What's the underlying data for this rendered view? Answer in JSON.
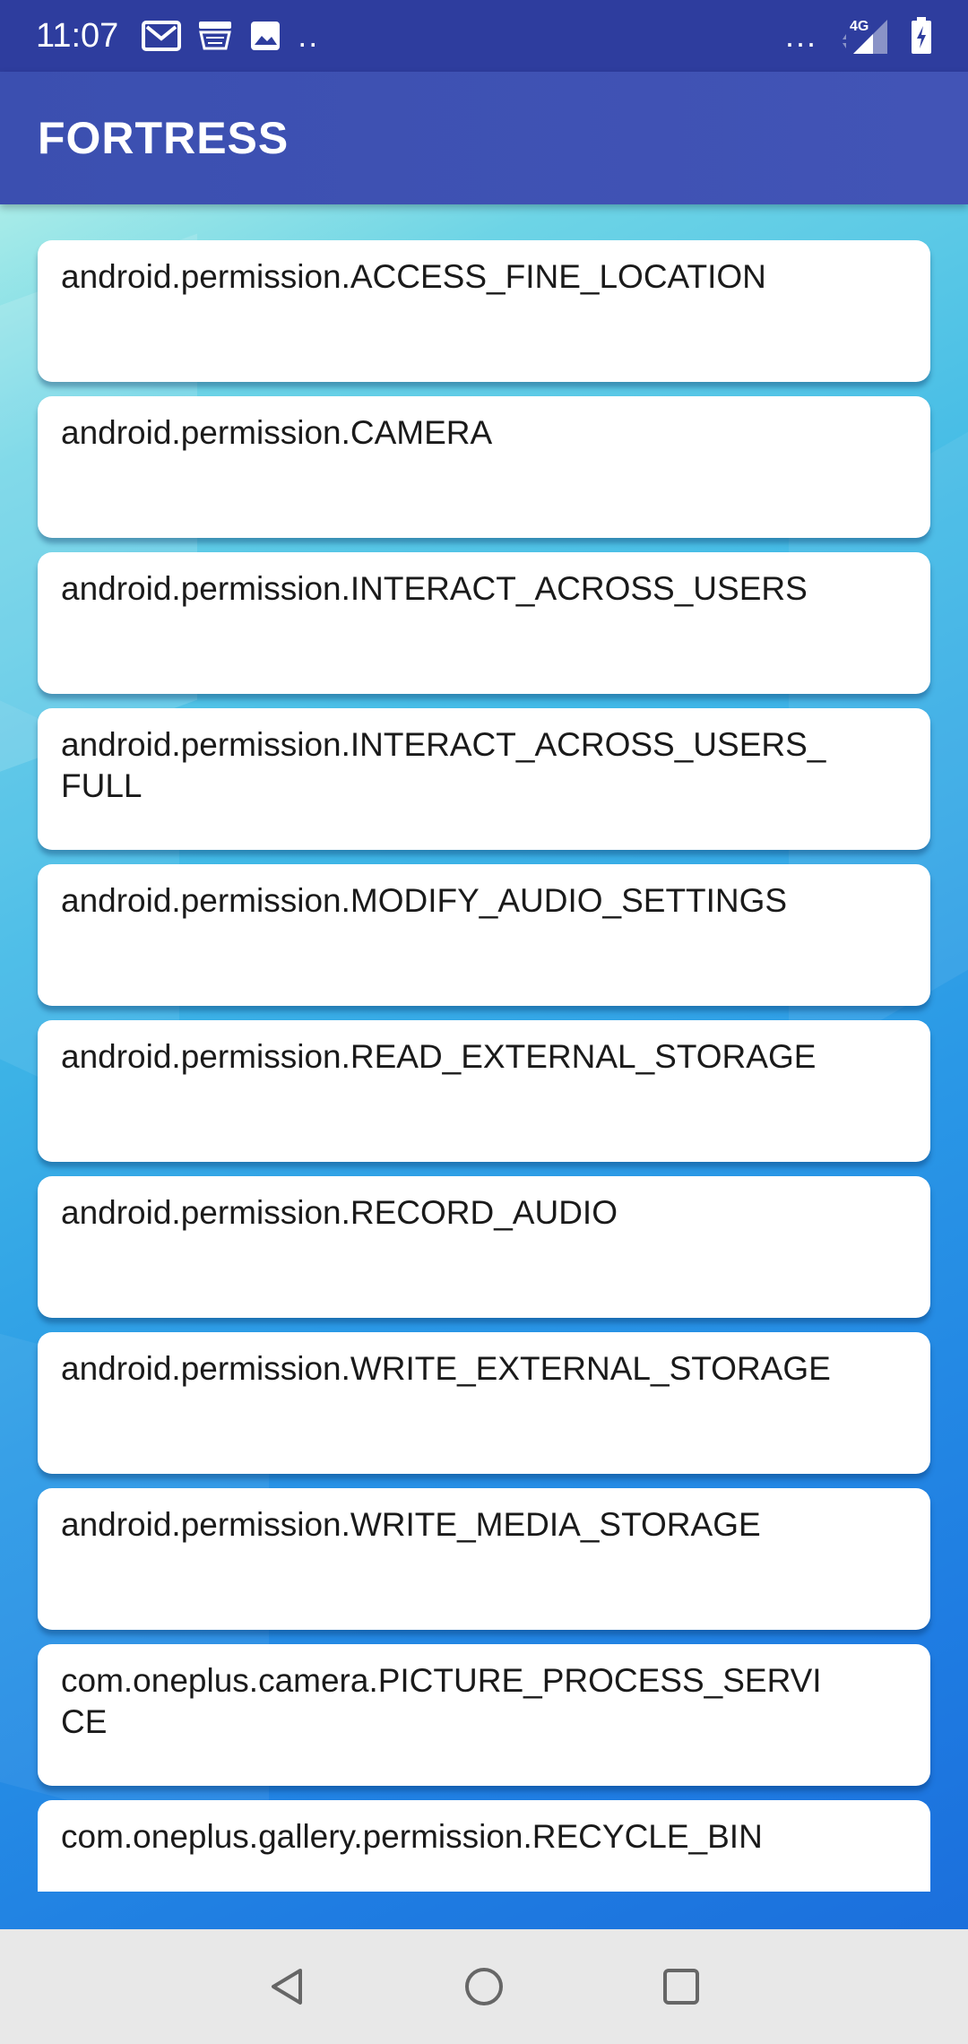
{
  "status_bar": {
    "time": "11:07",
    "notifications": [
      "gmail-icon",
      "amazon-icon",
      "image-icon"
    ],
    "more_indicator": "..",
    "overflow_indicator": "...",
    "network": "4G",
    "icons": [
      "signal-icon",
      "battery-charging-icon"
    ]
  },
  "app_bar": {
    "title": "FORTRESS"
  },
  "permissions": [
    "android.permission.ACCESS_FINE_LOCATION",
    "android.permission.CAMERA",
    "android.permission.INTERACT_ACROSS_USERS",
    "android.permission.INTERACT_ACROSS_USERS_FULL",
    "android.permission.MODIFY_AUDIO_SETTINGS",
    "android.permission.READ_EXTERNAL_STORAGE",
    "android.permission.RECORD_AUDIO",
    "android.permission.WRITE_EXTERNAL_STORAGE",
    "android.permission.WRITE_MEDIA_STORAGE",
    "com.oneplus.camera.PICTURE_PROCESS_SERVICE",
    "com.oneplus.gallery.permission.RECYCLE_BIN"
  ],
  "nav_bar": {
    "buttons": [
      "back-icon",
      "home-icon",
      "recents-icon"
    ]
  },
  "colors": {
    "status_bar": "#2e3d9e",
    "app_bar": "#4254b6",
    "nav_bar": "#e8e8e8"
  }
}
